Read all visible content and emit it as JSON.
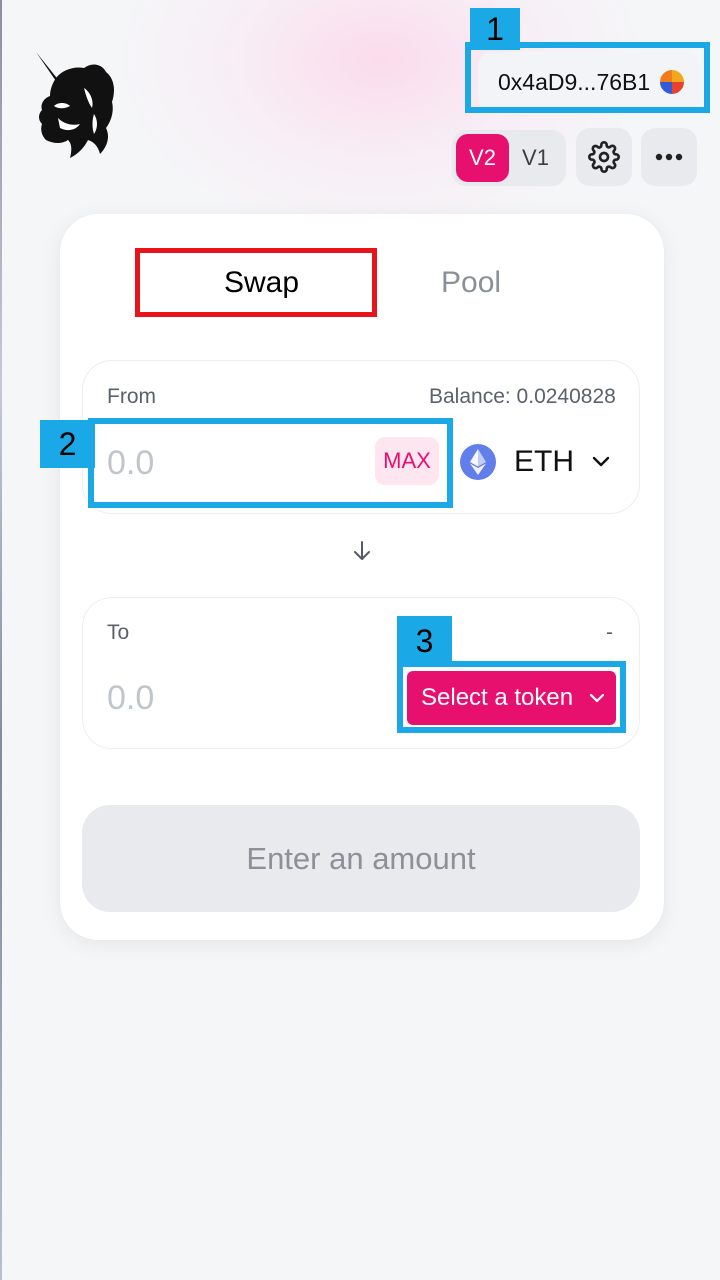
{
  "header": {
    "account_address": "0x4aD9...76B1",
    "versions": [
      {
        "label": "V2",
        "active": true
      },
      {
        "label": "V1",
        "active": false
      }
    ],
    "icons": [
      "unicorn-logo",
      "settings-gear-icon",
      "more-dots-icon"
    ]
  },
  "swap": {
    "tabs": [
      {
        "label": "Swap",
        "active": true
      },
      {
        "label": "Pool",
        "active": false
      }
    ],
    "from": {
      "label": "From",
      "balance": "Balance: 0.0240828",
      "amount_placeholder": "0.0",
      "max_label": "MAX",
      "token_symbol": "ETH"
    },
    "to": {
      "label": "To",
      "balance": "-",
      "amount_placeholder": "0.0",
      "select_token_label": "Select a token"
    },
    "action_label": "Enter an amount"
  },
  "annotations": [
    {
      "number": "1"
    },
    {
      "number": "2"
    },
    {
      "number": "3"
    }
  ],
  "colors": {
    "accent_pink": "#e8106e",
    "annotation_blue": "#1ba8e6",
    "highlight_red": "#e8141b",
    "eth_blue": "#627eea"
  }
}
